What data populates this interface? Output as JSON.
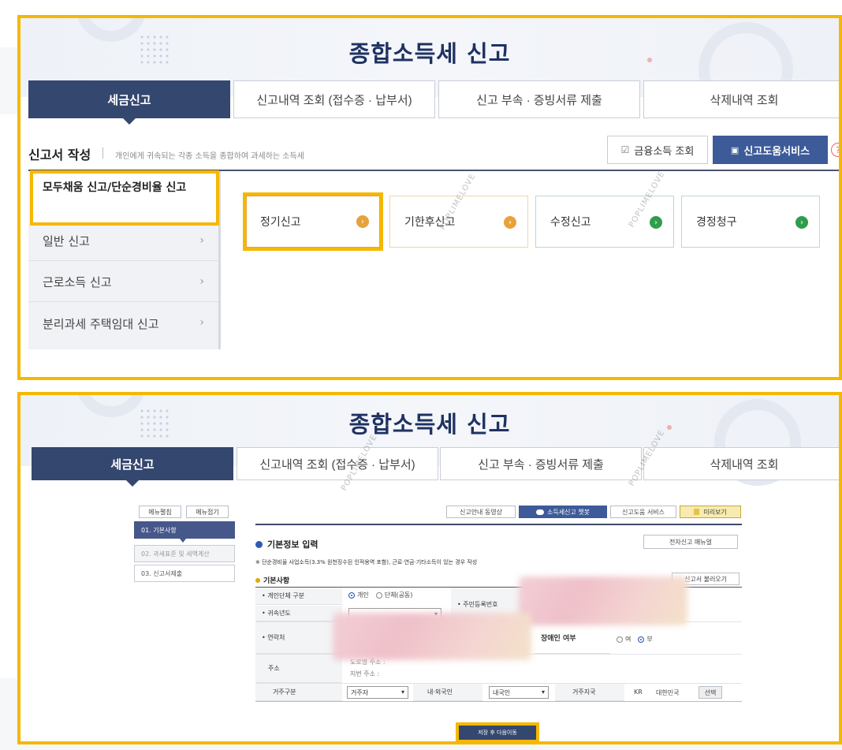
{
  "colors": {
    "highlight": "#f5b800",
    "navy": "#34476f",
    "title": "#1f3262",
    "help_button": "#3d5a99",
    "card_orange": "#e8a23a",
    "card_green": "#2e9e4c"
  },
  "top": {
    "title": "종합소득세 신고",
    "tabs": [
      "세금신고",
      "신고내역 조회 (접수증 · 납부서)",
      "신고 부속 · 증빙서류 제출",
      "삭제내역 조회"
    ],
    "section_title": "신고서 작성",
    "section_desc": "개인에게 귀속되는 각종 소득을 종합하여 과세하는 소득세",
    "btn_financial": "금융소득 조회",
    "btn_help_service": "신고도움서비스",
    "help_mark": "?",
    "side_menu": {
      "active": "모두채움 신고/단순경비율 신고",
      "items": [
        "일반 신고",
        "근로소득 신고",
        "분리과세 주택임대 신고"
      ],
      "chevron": "›"
    },
    "type_cards": [
      "정기신고",
      "기한후신고",
      "수정신고",
      "경정청구"
    ],
    "card_arrow": "›"
  },
  "bottom": {
    "title": "종합소득세 신고",
    "tabs": [
      "세금신고",
      "신고내역 조회 (접수증 · 납부서)",
      "신고 부속 · 증빙서류 제출",
      "삭제내역 조회"
    ],
    "menu_buttons": [
      "메뉴펼침",
      "메뉴접기"
    ],
    "steps": [
      "01. 기본사항",
      "02. 과세표준 및 세액계산",
      "03. 신고서제출"
    ],
    "toolbar": [
      "신고안내 동영상",
      "소득세신고 챗봇",
      "신고도움 서비스",
      "미리보기"
    ],
    "form_title": "기본정보 입력",
    "electronic_manual": "전자신고 매뉴얼",
    "note": "※ 단순경비율 사업소득(3.3% 원천징수된 인적용역 포함), 근로·연금·기타소득이 있는 경우 작성",
    "section": "기본사항",
    "load_button": "신고서 불러오기",
    "fields": {
      "individual_group": "개인단체 구분",
      "individual": "개인",
      "group": "단체(공동)",
      "attribution_year": "귀속년도",
      "resident_number": "주민등록번호",
      "contact": "연락처",
      "disability": "장애인 여부",
      "yes": "여",
      "no": "부",
      "address": "주소",
      "road_address": "도로명 주소 :",
      "lot_address": "지번 주소 :",
      "residence_type": "거주구분",
      "residence_value": "거주자",
      "domestic_foreign": "내·외국인",
      "domestic_value": "내국인",
      "residence_country": "거주지국",
      "country_code": "KR",
      "country_name": "대한민국",
      "select_btn": "선택"
    },
    "submit": "저장 후 다음이동"
  },
  "watermark": "POPLIMELOVE"
}
